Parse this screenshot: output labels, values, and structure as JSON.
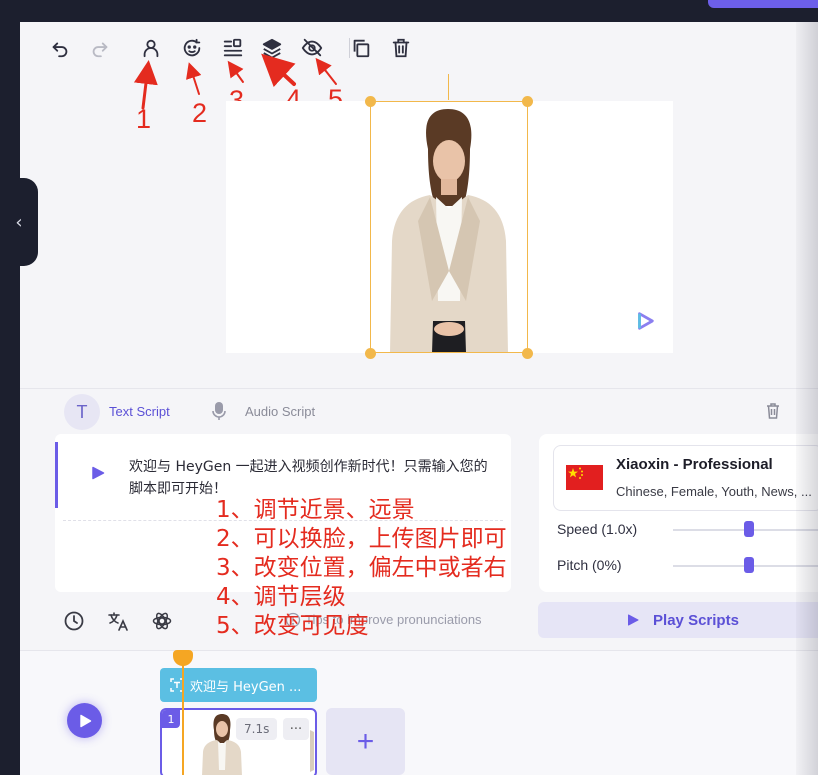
{
  "toolbar": {
    "icons": [
      "undo-icon",
      "redo-icon",
      "avatar-icon",
      "face-swap-icon",
      "position-align-icon",
      "layers-icon",
      "visibility-icon",
      "duplicate-icon",
      "delete-icon"
    ]
  },
  "annotations": {
    "numbers": [
      "1",
      "2",
      "3",
      "4",
      "5"
    ],
    "lines": [
      "1、调节近景、远景",
      "2、可以换脸，上传图片即可",
      "3、改变位置，偏左中或者右",
      "4、调节层级",
      "5、改变可见度"
    ],
    "color": "#e42b1f"
  },
  "script": {
    "badge_letter": "T",
    "tab_text": "Text Script",
    "tab_audio": "Audio Script",
    "text": "欢迎与 HeyGen 一起进入视频创作新时代！只需输入您的脚本即可开始！",
    "tips": "Tips to improve pronunciations"
  },
  "voice": {
    "name": "Xiaoxin - Professional",
    "description": "Chinese, Female, Youth, News, ...",
    "speed_label": "Speed (1.0x)",
    "speed_value": 1.0,
    "pitch_label": "Pitch (0%)",
    "pitch_value": 0
  },
  "play_scripts_label": "Play Scripts",
  "timeline": {
    "text_track_label": "欢迎与 HeyGen ...",
    "scene_number": "1",
    "scene_duration": "7.1s",
    "more_label": "···",
    "add_label": "+"
  },
  "colors": {
    "accent": "#6b5ce7",
    "selection": "#f2b84b",
    "playhead": "#f5a623",
    "text_track": "#5bbfe3"
  }
}
